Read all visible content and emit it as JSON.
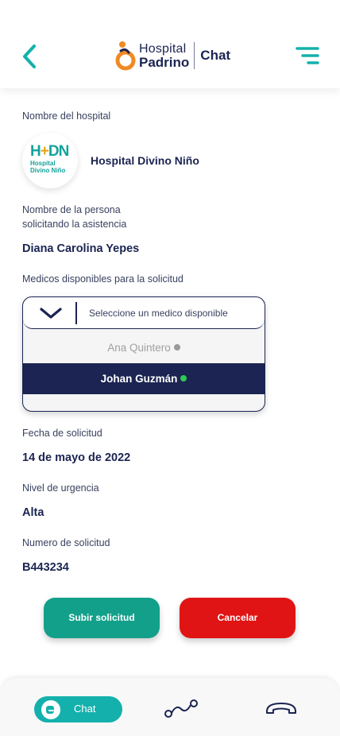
{
  "header": {
    "logo_line1": "Hospital",
    "logo_line2": "Padrino",
    "title": "Chat"
  },
  "form": {
    "hospital_label": "Nombre del hospital",
    "hospital_name": "Hospital Divino Niño",
    "hospital_logo_text": "HDN",
    "hospital_logo_sub": "Hospital Divino Niño",
    "person_label_line1": "Nombre de la persona",
    "person_label_line2": "solicitando la asistencia",
    "person_name": "Diana Carolina Yepes",
    "doctors_label": "Medicos disponibles para la solicitud",
    "doctors_placeholder": "Seleccione un medico disponible",
    "doctors_options": [
      {
        "name": "Ana Quintero",
        "status": "unavailable",
        "status_color": "#9a9a9a"
      },
      {
        "name": "Johan Guzmán",
        "status": "available",
        "status_color": "#2ecc52"
      }
    ],
    "date_label": "Fecha de solicitud",
    "date_value": "14 de mayo de 2022",
    "urgency_label": "Nivel de urgencia",
    "urgency_value": "Alta",
    "request_label": "Numero de solicitud",
    "request_value": "B443234"
  },
  "actions": {
    "submit_label": "Subir solicitud",
    "cancel_label": "Cancelar"
  },
  "bottom_nav": {
    "chat_label": "Chat",
    "active": "chat",
    "icons": [
      "chat-icon",
      "route-icon",
      "phone-hangup-icon"
    ]
  },
  "colors": {
    "navy": "#1b2452",
    "teal": "#14b1ac",
    "green_button": "#13a08a",
    "red_button": "#e01414",
    "orange_logo": "#f08a24"
  }
}
